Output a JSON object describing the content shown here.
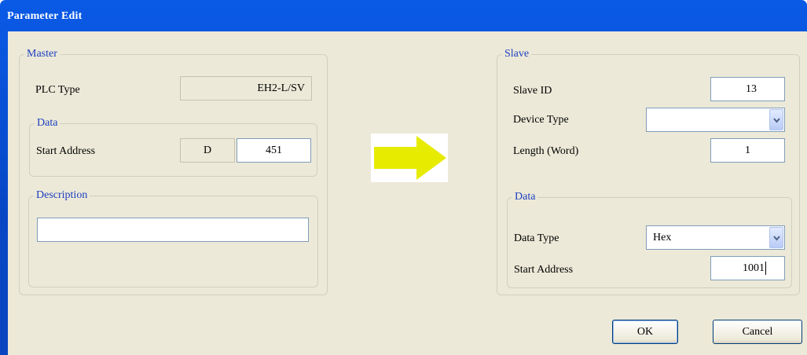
{
  "window": {
    "title": "Parameter Edit"
  },
  "master": {
    "legend": "Master",
    "plc_type_label": "PLC Type",
    "plc_type_value": "EH2-L/SV",
    "data": {
      "legend": "Data",
      "start_address_label": "Start Address",
      "device_prefix": "D",
      "start_address_value": "451"
    }
  },
  "description": {
    "legend": "Description",
    "value": ""
  },
  "slave": {
    "legend": "Slave",
    "slave_id_label": "Slave ID",
    "slave_id_value": "13",
    "device_type_label": "Device Type",
    "device_type_value": "",
    "length_label": "Length (Word)",
    "length_value": "1",
    "data": {
      "legend": "Data",
      "data_type_label": "Data Type",
      "data_type_value": "Hex",
      "start_address_label": "Start Address",
      "start_address_value": "1001"
    }
  },
  "buttons": {
    "ok": "OK",
    "cancel": "Cancel"
  },
  "colors": {
    "title_bar": "#0a5ae6",
    "dialog_bg": "#ece9d8",
    "legend_text": "#1c3fbf",
    "arrow": "#e6eb00"
  },
  "icons": {
    "transfer_arrow": "right-arrow-icon",
    "dropdown": "chevron-down-icon"
  }
}
